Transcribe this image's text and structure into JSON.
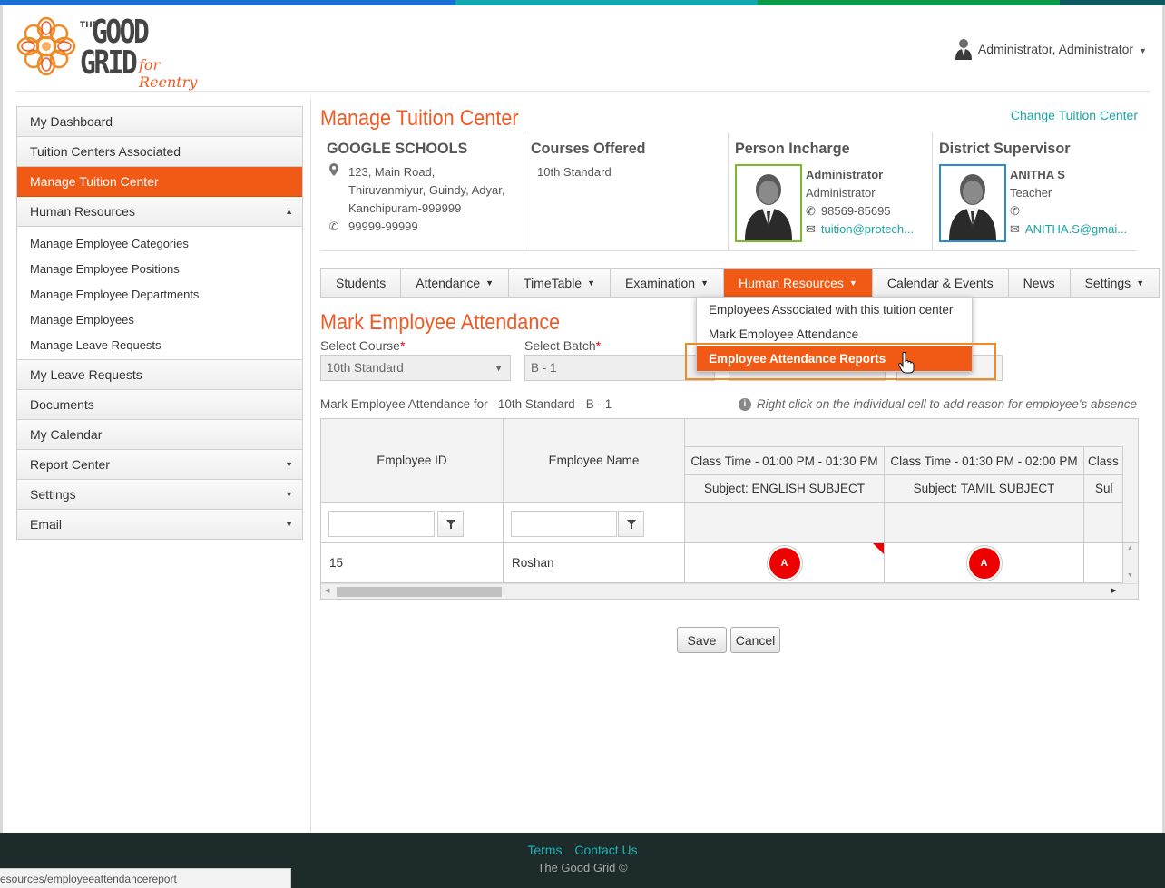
{
  "brand": {
    "the": "THE",
    "good": "GOOD",
    "grid": "GRID",
    "tagline": "for Reentry",
    "colors": {
      "accent": "#f05a24",
      "teal": "#1aa5a5",
      "footer": "#1e2b2b"
    }
  },
  "topbar_colors": [
    "#1a6fd0",
    "#12a6b0",
    "#0a9a4a",
    "#0e5a60"
  ],
  "user": {
    "name": "Administrator, Administrator",
    "icon": "user-avatar-icon"
  },
  "sidebar": {
    "items": [
      {
        "label": "My Dashboard"
      },
      {
        "label": "Tuition Centers Associated"
      },
      {
        "label": "Manage Tuition Center",
        "active": true
      },
      {
        "label": "Human Resources",
        "expanded": true
      }
    ],
    "submenu": [
      "Manage Employee Categories",
      "Manage Employee Positions",
      "Manage Employee Departments",
      "Manage Employees",
      "Manage Leave Requests"
    ],
    "bottom_items": [
      {
        "label": "My Leave Requests",
        "arrow": ""
      },
      {
        "label": "Documents",
        "arrow": ""
      },
      {
        "label": "My Calendar",
        "arrow": ""
      },
      {
        "label": "Report Center",
        "arrow": "▼"
      },
      {
        "label": "Settings",
        "arrow": "▼"
      },
      {
        "label": "Email",
        "arrow": "▼"
      }
    ]
  },
  "page": {
    "title": "Manage Tuition Center",
    "change_link": "Change Tuition Center"
  },
  "center": {
    "name": "GOOGLE SCHOOLS",
    "address1": "123, Main Road,",
    "address2": "Thiruvanmiyur, Guindy, Adyar,",
    "address3": "Kanchipuram-999999",
    "phone": "99999-99999"
  },
  "courses": {
    "heading": "Courses Offered",
    "item": "10th Standard"
  },
  "incharge": {
    "heading": "Person Incharge",
    "name": "Administrator",
    "role": "Administrator",
    "phone": "98569-85695",
    "email": "tuition@protech..."
  },
  "supervisor": {
    "heading": "District Supervisor",
    "name": "ANITHA S",
    "role": "Teacher",
    "phone": "",
    "email": "ANITHA.S@gmai..."
  },
  "tabs": [
    {
      "label": "Students",
      "caret": ""
    },
    {
      "label": "Attendance",
      "caret": "▼"
    },
    {
      "label": "TimeTable",
      "caret": "▼"
    },
    {
      "label": "Examination",
      "caret": "▼"
    },
    {
      "label": "Human Resources",
      "caret": "▼",
      "active": true
    },
    {
      "label": "Calendar & Events",
      "caret": ""
    },
    {
      "label": "News",
      "caret": ""
    },
    {
      "label": "Settings",
      "caret": "▼"
    }
  ],
  "dropdown": {
    "items": [
      "Employees Associated with this tuition center",
      "Mark Employee Attendance",
      "Employee Attendance Reports"
    ],
    "highlighted": 2
  },
  "form": {
    "title": "Mark Employee Attendance",
    "course_label": "Select Course",
    "course_value": "10th Standard",
    "batch_label": "Select Batch",
    "batch_value": "B - 1",
    "required_mark": "*"
  },
  "mark_for": {
    "prefix": "Mark Employee Attendance for",
    "value": "10th Standard - B - 1"
  },
  "note": "Right click on the individual cell to add reason for employee's absence",
  "grid": {
    "col_id": "Employee ID",
    "col_name": "Employee Name",
    "periods": [
      {
        "time": "Class Time - 01:00 PM - 01:30 PM",
        "subject": "Subject:  ENGLISH SUBJECT"
      },
      {
        "time": "Class Time - 01:30 PM - 02:00 PM",
        "subject": "Subject:  TAMIL SUBJECT"
      },
      {
        "time": "Class",
        "subject": "Sul"
      }
    ],
    "rows": [
      {
        "id": "15",
        "name": "Roshan",
        "marks": [
          "A",
          "A"
        ]
      }
    ]
  },
  "buttons": {
    "save": "Save",
    "cancel": "Cancel"
  },
  "footer": {
    "terms": "Terms",
    "contact": "Contact Us",
    "copy": "The Good Grid ©"
  },
  "status_url": "esources/employeeattendancereport"
}
